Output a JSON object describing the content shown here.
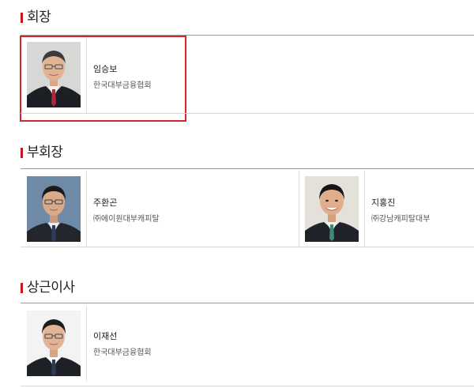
{
  "sections": [
    {
      "title": "회장",
      "members": [
        {
          "name": "임승보",
          "org": "한국대부금융협회",
          "photo_icon": "person-portrait-icon"
        }
      ]
    },
    {
      "title": "부회장",
      "members": [
        {
          "name": "주환곤",
          "org": "㈜에이원대부캐피탈",
          "photo_icon": "person-portrait-icon"
        },
        {
          "name": "지홍진",
          "org": "㈜강남캐피탈대부",
          "photo_icon": "person-portrait-icon"
        }
      ]
    },
    {
      "title": "상근이사",
      "members": [
        {
          "name": "이재선",
          "org": "한국대부금융협회",
          "photo_icon": "person-portrait-icon"
        }
      ]
    }
  ],
  "colors": {
    "accent": "#c8161d",
    "highlight_border": "#d7262b"
  }
}
